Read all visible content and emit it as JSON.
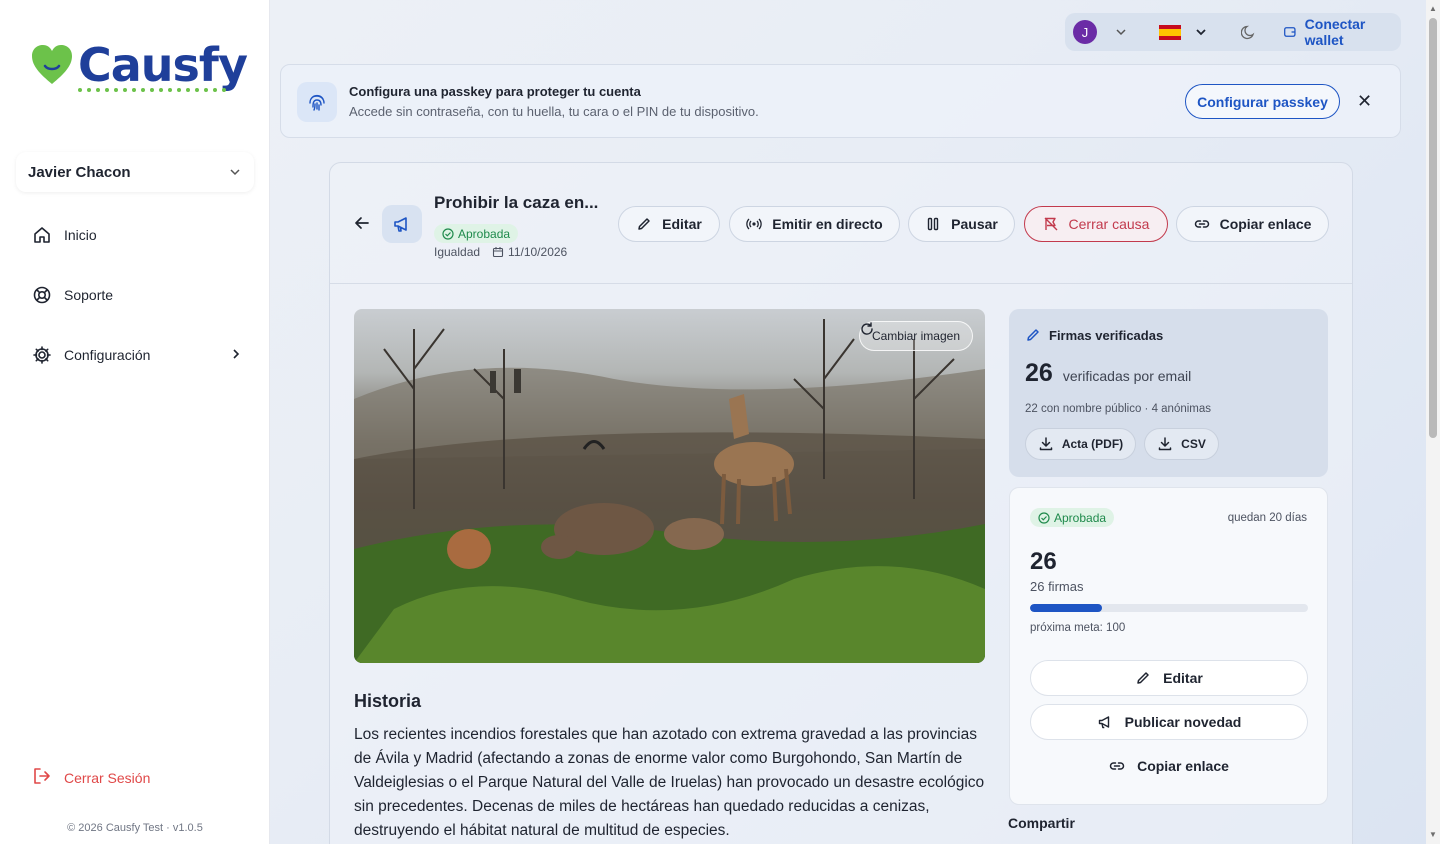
{
  "brand": {
    "name": "Causfy",
    "heart_color": "#6cc24a",
    "text_color": "#1f3f9a"
  },
  "sidebar": {
    "user_name": "Javier Chacon",
    "items": [
      {
        "label": "Inicio",
        "icon": "home-icon"
      },
      {
        "label": "Soporte",
        "icon": "lifebuoy-icon"
      },
      {
        "label": "Configuración",
        "icon": "gear-icon"
      }
    ],
    "logout_label": "Cerrar Sesión",
    "version": "© 2026 Causfy Test · v1.0.5"
  },
  "topbar": {
    "avatar_initial": "J",
    "language": "es",
    "theme_icon": "moon-icon",
    "wallet_label": "Conectar wallet"
  },
  "banner": {
    "title": "Configura una passkey para proteger tu cuenta",
    "subtitle": "Accede sin contraseña, con tu huella, tu cara o el PIN de tu dispositivo.",
    "button": "Configurar passkey",
    "close": "✕"
  },
  "cause": {
    "title": "Prohibir la caza en...",
    "status": "Aprobada",
    "category": "Igualdad",
    "date": "11/10/2026",
    "actions": {
      "edit": "Editar",
      "live": "Emitir en directo",
      "pause": "Pausar",
      "close": "Cerrar causa",
      "copy": "Copiar enlace"
    },
    "change_image": "Cambiar imagen",
    "history_title": "Historia",
    "history_text": "Los recientes incendios forestales que han azotado con extrema gravedad a las provincias de Ávila y Madrid (afectando a zonas de enorme valor como Burgohondo, San Martín de Valdeiglesias o el Parque Natural del Valle de Iruelas) han provocado un desastre ecológico sin precedentes. Decenas de miles de hectáreas han quedado reducidas a cenizas, destruyendo el hábitat natural de multitud de especies."
  },
  "signatures": {
    "title": "Firmas verificadas",
    "count": "26",
    "count_label": "verificadas por email",
    "detail": "22 con nombre público · 4 anónimas",
    "pdf_label": "Acta (PDF)",
    "csv_label": "CSV"
  },
  "progress": {
    "status": "Aprobada",
    "remaining": "quedan 20 días",
    "count": "26",
    "count_label": "26 firmas",
    "fraction": 0.26,
    "next_goal": "próxima meta: 100",
    "edit": "Editar",
    "publish": "Publicar novedad",
    "copy": "Copiar enlace"
  },
  "share_label": "Compartir"
}
